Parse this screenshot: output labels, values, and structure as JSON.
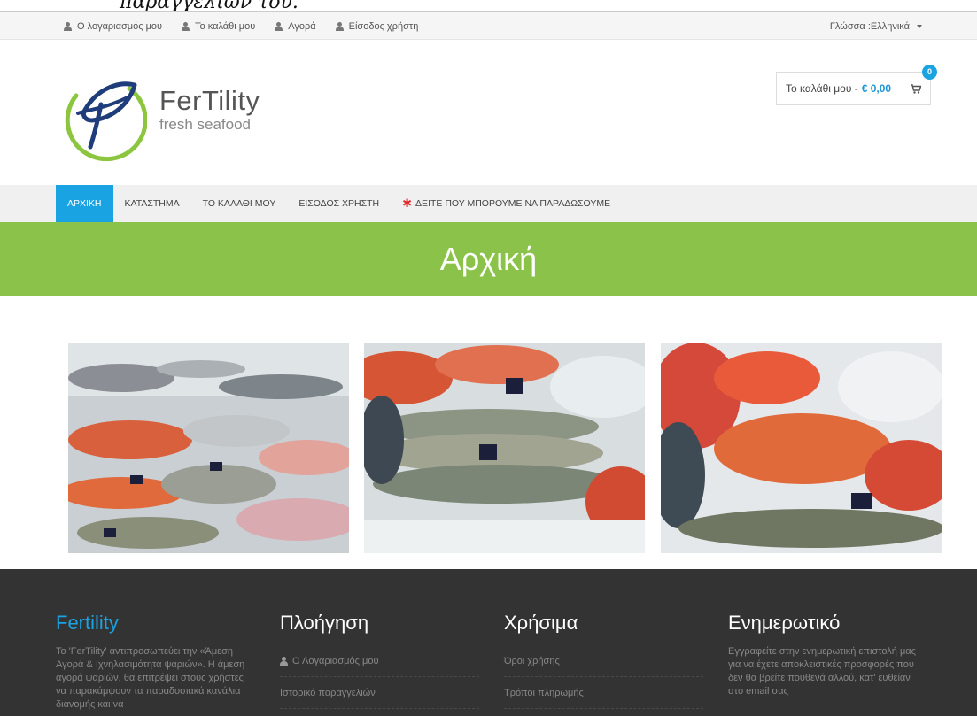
{
  "top_clip_text": "παραγγελιών του.",
  "topbar": {
    "links": [
      {
        "label": "Ο λογαριασμός μου",
        "icon": "user-icon"
      },
      {
        "label": "Το καλάθι μου",
        "icon": "user-icon"
      },
      {
        "label": "Αγορά",
        "icon": "user-icon"
      },
      {
        "label": "Είσοδος χρήστη",
        "icon": "user-icon"
      }
    ],
    "language_label": "Γλώσσα :Ελληνικά"
  },
  "logo": {
    "name": "FerTility",
    "tagline": "fresh seafood"
  },
  "cart": {
    "label": "Το καλάθι μου -",
    "amount": "€ 0,00",
    "count": "0"
  },
  "nav": {
    "items": [
      {
        "label": "ΑΡΧΙΚΗ",
        "active": true
      },
      {
        "label": "ΚΑΤΑΣΤΗΜΑ"
      },
      {
        "label": "ΤΟ ΚΑΛΑΘΙ ΜΟΥ"
      },
      {
        "label": "ΕΙΣΟΔΟΣ ΧΡΗΣΤΗ"
      },
      {
        "label": "ΔΕΙΤΕ ΠΟΥ ΜΠΟΡΟΥΜΕ ΝΑ ΠΑΡΑΔΩΣΟΥΜΕ",
        "star": "✱"
      }
    ]
  },
  "banner": {
    "title": "Αρχική"
  },
  "footer": {
    "about": {
      "title": "Fertility",
      "text": "Το 'FerTility' αντιπροσωπεύει την «Άμεση Αγορά & Ιχνηλασιμότητα ψαριών». Η άμεση αγορά ψαριών, θα επιτρέψει στους χρήστες να παρακάμψουν τα παραδοσιακά κανάλια διανομής και να"
    },
    "navigation": {
      "title": "Πλοήγηση",
      "links": [
        "Ο Λογαριασμός μου",
        "Ιστορικό παραγγελιών"
      ]
    },
    "useful": {
      "title": "Χρήσιμα",
      "links": [
        "Όροι χρήσης",
        "Τρόποι πληρωμής"
      ]
    },
    "newsletter": {
      "title": "Ενημερωτικό",
      "text": "Εγγραφείτε στην ενημερωτική επιστολή μας για να έχετε αποκλειστικές προσφορές που δεν θα βρείτε πουθενά αλλού, κατ' ευθείαν στο email σας"
    }
  },
  "colors": {
    "accent": "#1aa3e3",
    "banner": "#8bc34a",
    "footer_bg": "#333333"
  }
}
